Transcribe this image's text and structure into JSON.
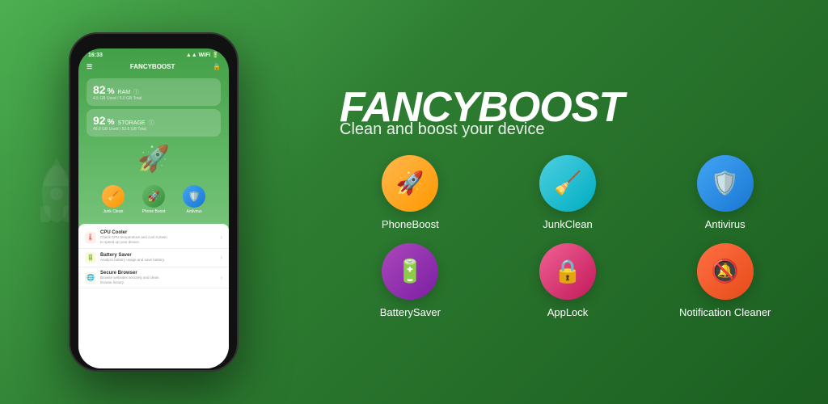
{
  "brand": {
    "name_italic": "FANCY",
    "name_bold": "BOOST",
    "subtitle": "Clean and boost your device"
  },
  "phone": {
    "time": "16:33",
    "app_name": "FANCYBOOST",
    "ram_percent": "82",
    "ram_label": "RAM",
    "ram_used": "4.5 GB Used / 5.0 GB Total",
    "storage_percent": "92",
    "storage_label": "STORAGE",
    "storage_used": "48.8 GB Used / 52.6 GB Total",
    "actions": [
      {
        "label": "Junk Clean",
        "color": "orange"
      },
      {
        "label": "Phone Boost",
        "color": "green"
      },
      {
        "label": "Antivirus",
        "color": "blue"
      }
    ],
    "list_items": [
      {
        "title": "CPU Cooler",
        "desc": "Check CPU temperature and cool it down\nto speed up your device.",
        "color": "#f44336"
      },
      {
        "title": "Battery Saver",
        "desc": "Analyze battery usage and save battery.",
        "color": "#ff9800"
      },
      {
        "title": "Secure Browser",
        "desc": "Browse websites securely and clean\nbrowse history.",
        "color": "#4caf50"
      }
    ]
  },
  "features": [
    {
      "id": "phone-boost",
      "label": "PhoneBoost",
      "color_class": "orange",
      "icon": "🚀"
    },
    {
      "id": "junk-clean",
      "label": "JunkClean",
      "color_class": "teal",
      "icon": "🧹"
    },
    {
      "id": "antivirus",
      "label": "Antivirus",
      "color_class": "blue",
      "icon": "🛡️"
    },
    {
      "id": "battery-saver",
      "label": "BatterySaver",
      "color_class": "purple",
      "icon": "🔋"
    },
    {
      "id": "app-lock",
      "label": "AppLock",
      "color_class": "pink",
      "icon": "🔒"
    },
    {
      "id": "notification-cleaner",
      "label": "Notification Cleaner",
      "color_class": "red-orange",
      "icon": "🔕"
    }
  ]
}
